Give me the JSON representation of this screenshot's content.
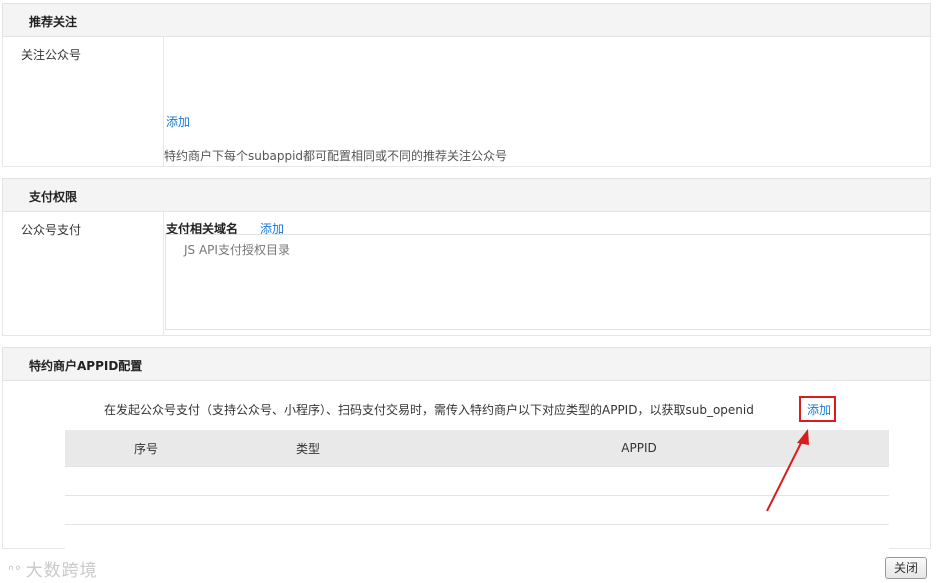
{
  "recommend": {
    "header": "推荐关注",
    "label": "关注公众号",
    "add_link": "添加",
    "hint": "特约商户下每个subappid都可配置相同或不同的推荐关注公众号"
  },
  "payment": {
    "header": "支付权限",
    "label": "公众号支付",
    "domain_title": "支付相关域名",
    "add_link": "添加",
    "jsapi_text": "JS API支付授权目录"
  },
  "appid": {
    "header": "特约商户APPID配置",
    "description": "在发起公众号支付（支持公众号、小程序）、扫码支付交易时，需传入特约商户以下对应类型的APPID，以获取sub_openid",
    "add_link": "添加",
    "table": {
      "columns": [
        "序号",
        "类型",
        "APPID"
      ],
      "rows": [
        [
          "",
          "",
          ""
        ],
        [
          "",
          "",
          ""
        ],
        [
          "",
          "",
          ""
        ]
      ]
    }
  },
  "footer": {
    "close_button": "关闭",
    "watermark": "大数跨境"
  },
  "colors": {
    "link": "#1a79d6",
    "annotation": "#d71d1d"
  }
}
